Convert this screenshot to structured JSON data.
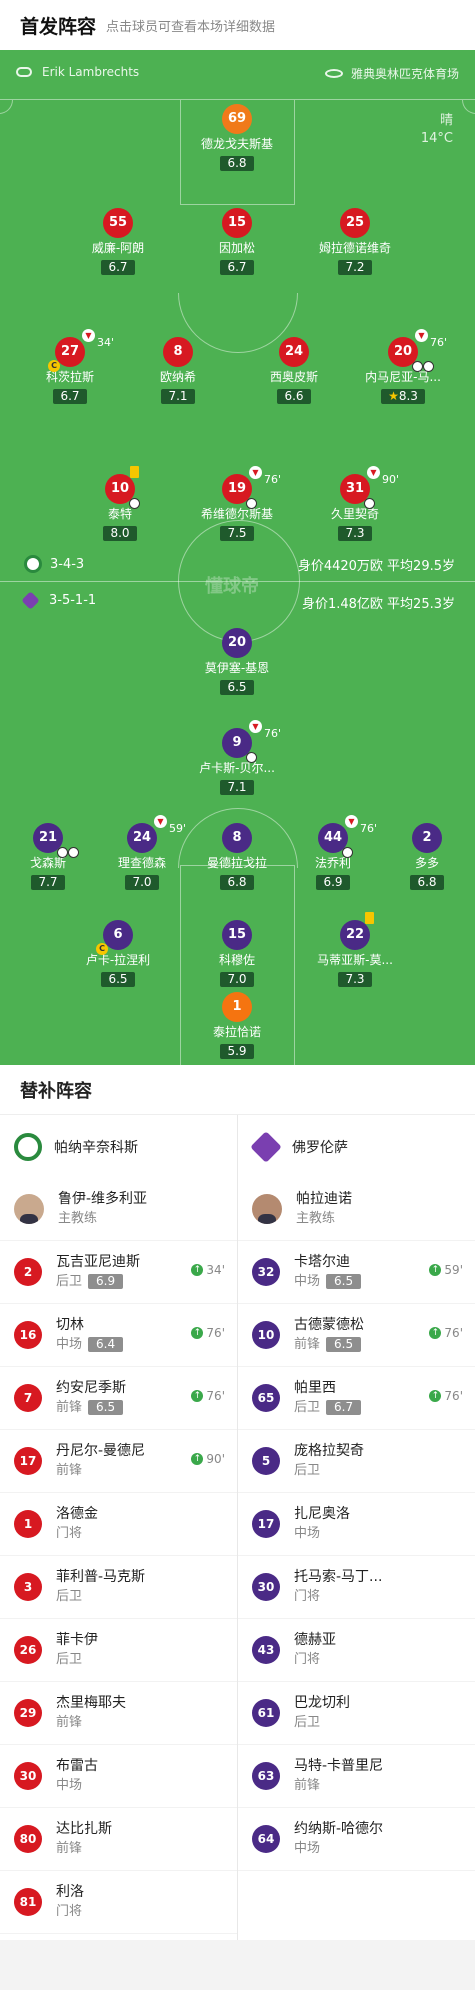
{
  "header": {
    "title": "首发阵容",
    "subtitle": "点击球员可查看本场详细数据"
  },
  "match": {
    "referee": "Erik Lambrechts",
    "venue": "雅典奥林匹克体育场",
    "weather": "晴",
    "temp": "14°C"
  },
  "home": {
    "formation": "3-4-3",
    "value": "身价4420万欧 平均29.5岁",
    "players": [
      {
        "num": "69",
        "name": "德龙戈夫斯基",
        "rating": "6.8"
      },
      {
        "num": "55",
        "name": "威廉-阿朗",
        "rating": "6.7"
      },
      {
        "num": "15",
        "name": "因加松",
        "rating": "6.7"
      },
      {
        "num": "25",
        "name": "姆拉德诺维奇",
        "rating": "7.2"
      },
      {
        "num": "27",
        "name": "科茨拉斯",
        "rating": "6.7",
        "sub": "34'"
      },
      {
        "num": "8",
        "name": "欧纳希",
        "rating": "7.1"
      },
      {
        "num": "24",
        "name": "西奥皮斯",
        "rating": "6.6"
      },
      {
        "num": "20",
        "name": "内马尼亚-马...",
        "rating": "8.3",
        "sub": "76'"
      },
      {
        "num": "10",
        "name": "泰特",
        "rating": "8.0"
      },
      {
        "num": "19",
        "name": "希维德尔斯基",
        "rating": "7.5",
        "sub": "76'"
      },
      {
        "num": "31",
        "name": "久里契奇",
        "rating": "7.3",
        "sub": "90'"
      }
    ]
  },
  "away": {
    "formation": "3-5-1-1",
    "value": "身价1.48亿欧 平均25.3岁",
    "players": [
      {
        "num": "20",
        "name": "莫伊塞-基恩",
        "rating": "6.5"
      },
      {
        "num": "9",
        "name": "卢卡斯-贝尔...",
        "rating": "7.1",
        "sub": "76'"
      },
      {
        "num": "21",
        "name": "戈森斯",
        "rating": "7.7"
      },
      {
        "num": "24",
        "name": "理查德森",
        "rating": "7.0",
        "sub": "59'"
      },
      {
        "num": "8",
        "name": "曼德拉戈拉",
        "rating": "6.8"
      },
      {
        "num": "44",
        "name": "法乔利",
        "rating": "6.9",
        "sub": "76'"
      },
      {
        "num": "2",
        "name": "多多",
        "rating": "6.8"
      },
      {
        "num": "6",
        "name": "卢卡-拉涅利",
        "rating": "6.5"
      },
      {
        "num": "15",
        "name": "科穆佐",
        "rating": "7.0"
      },
      {
        "num": "22",
        "name": "马蒂亚斯-莫...",
        "rating": "7.3"
      },
      {
        "num": "1",
        "name": "泰拉恰诺",
        "rating": "5.9"
      }
    ]
  },
  "watermark": "懂球帝",
  "subs": {
    "title": "替补阵容",
    "home_team": "帕纳辛奈科斯",
    "away_team": "佛罗伦萨",
    "home_coach": {
      "name": "鲁伊-维多利亚",
      "role": "主教练"
    },
    "away_coach": {
      "name": "帕拉迪诺",
      "role": "主教练"
    },
    "home": [
      {
        "num": "2",
        "name": "瓦吉亚尼迪斯",
        "pos": "后卫",
        "rating": "6.9",
        "on": "34'"
      },
      {
        "num": "16",
        "name": "切林",
        "pos": "中场",
        "rating": "6.4",
        "on": "76'"
      },
      {
        "num": "7",
        "name": "约安尼季斯",
        "pos": "前锋",
        "rating": "6.5",
        "on": "76'"
      },
      {
        "num": "17",
        "name": "丹尼尔-曼德尼",
        "pos": "前锋",
        "rating": "",
        "on": "90'"
      },
      {
        "num": "1",
        "name": "洛德金",
        "pos": "门将",
        "rating": "",
        "on": ""
      },
      {
        "num": "3",
        "name": "菲利普-马克斯",
        "pos": "后卫",
        "rating": "",
        "on": ""
      },
      {
        "num": "26",
        "name": "菲卡伊",
        "pos": "后卫",
        "rating": "",
        "on": ""
      },
      {
        "num": "29",
        "name": "杰里梅耶夫",
        "pos": "前锋",
        "rating": "",
        "on": ""
      },
      {
        "num": "30",
        "name": "布雷古",
        "pos": "中场",
        "rating": "",
        "on": ""
      },
      {
        "num": "80",
        "name": "达比扎斯",
        "pos": "前锋",
        "rating": "",
        "on": ""
      },
      {
        "num": "81",
        "name": "利洛",
        "pos": "门将",
        "rating": "",
        "on": ""
      }
    ],
    "away": [
      {
        "num": "32",
        "name": "卡塔尔迪",
        "pos": "中场",
        "rating": "6.5",
        "on": "59'"
      },
      {
        "num": "10",
        "name": "古德蒙德松",
        "pos": "前锋",
        "rating": "6.5",
        "on": "76'"
      },
      {
        "num": "65",
        "name": "帕里西",
        "pos": "后卫",
        "rating": "6.7",
        "on": "76'"
      },
      {
        "num": "5",
        "name": "庞格拉契奇",
        "pos": "后卫",
        "rating": "",
        "on": ""
      },
      {
        "num": "17",
        "name": "扎尼奥洛",
        "pos": "中场",
        "rating": "",
        "on": ""
      },
      {
        "num": "30",
        "name": "托马索-马丁...",
        "pos": "门将",
        "rating": "",
        "on": ""
      },
      {
        "num": "43",
        "name": "德赫亚",
        "pos": "门将",
        "rating": "",
        "on": ""
      },
      {
        "num": "61",
        "name": "巴龙切利",
        "pos": "后卫",
        "rating": "",
        "on": ""
      },
      {
        "num": "63",
        "name": "马特-卡普里尼",
        "pos": "前锋",
        "rating": "",
        "on": ""
      },
      {
        "num": "64",
        "name": "约纳斯-哈德尔",
        "pos": "中场",
        "rating": "",
        "on": ""
      }
    ]
  },
  "colors": {
    "home": "#d71921",
    "away": "#4a2a86",
    "pitch": "#4db152",
    "gk_home": "#f07a1a",
    "gk_away": "#f57410"
  }
}
